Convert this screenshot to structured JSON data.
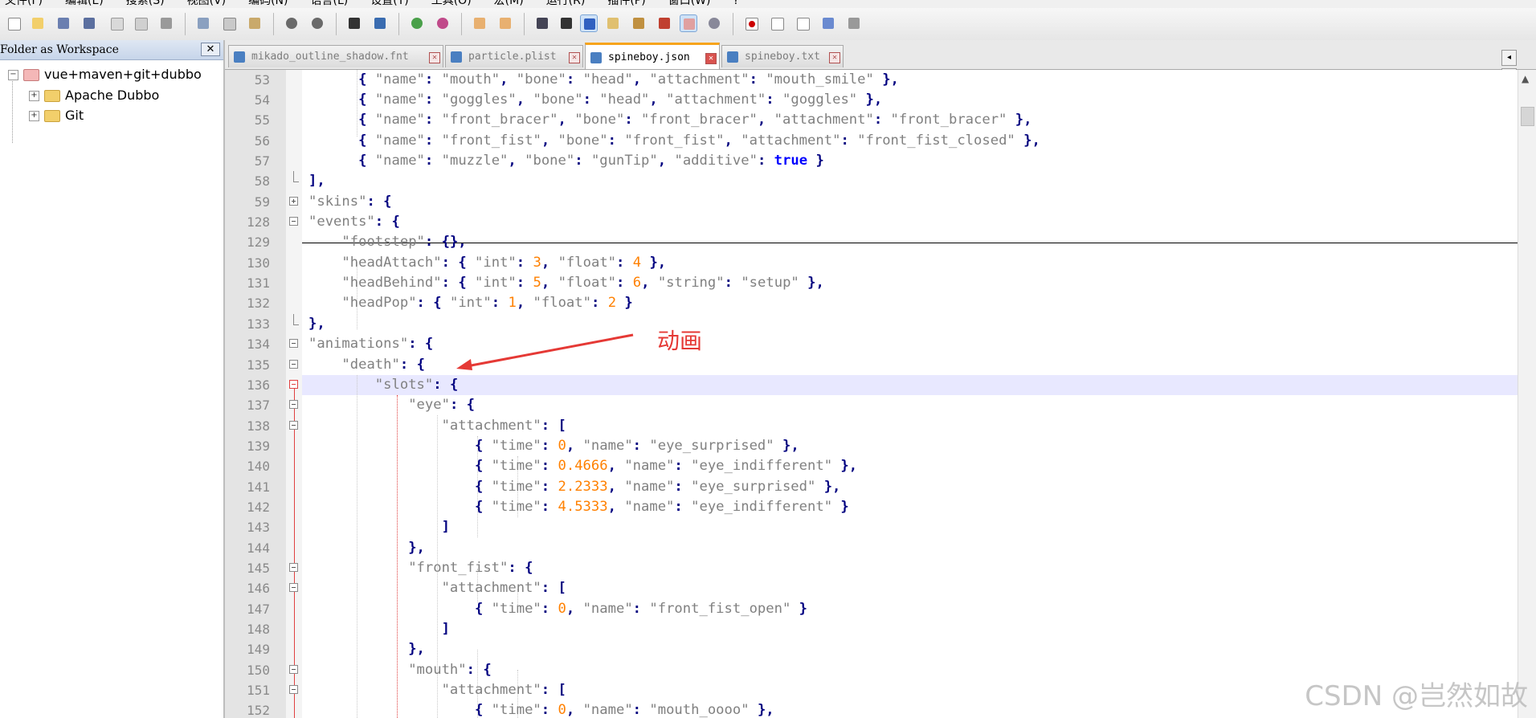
{
  "menu": [
    "文件(F)",
    "编辑(E)",
    "搜索(S)",
    "视图(V)",
    "编码(N)",
    "语言(L)",
    "设置(T)",
    "工具(O)",
    "宏(M)",
    "运行(R)",
    "插件(P)",
    "窗口(W)",
    "?"
  ],
  "panel": {
    "title": "Folder as Workspace",
    "close": "✕",
    "tree": [
      {
        "label": "vue+maven+git+dubbo",
        "expand": "−"
      },
      {
        "label": "Apache Dubbo",
        "expand": "+"
      },
      {
        "label": "Git",
        "expand": "+"
      }
    ]
  },
  "tabs": [
    {
      "label": "mikado_outline_shadow.fnt",
      "close": "✕"
    },
    {
      "label": "particle.plist",
      "close": "✕"
    },
    {
      "label": "spineboy.json",
      "close": "✕"
    },
    {
      "label": "spineboy.txt",
      "close": "✕"
    }
  ],
  "tabnav": [
    "◂",
    "▸"
  ],
  "editor": {
    "lines": [
      {
        "num": "53"
      },
      {
        "num": "54"
      },
      {
        "num": "55"
      },
      {
        "num": "56"
      },
      {
        "num": "57"
      },
      {
        "num": "58"
      },
      {
        "num": "59"
      },
      {
        "num": "128"
      },
      {
        "num": "129"
      },
      {
        "num": "130"
      },
      {
        "num": "131"
      },
      {
        "num": "132"
      },
      {
        "num": "133"
      },
      {
        "num": "134"
      },
      {
        "num": "135"
      },
      {
        "num": "136"
      },
      {
        "num": "137"
      },
      {
        "num": "138"
      },
      {
        "num": "139"
      },
      {
        "num": "140"
      },
      {
        "num": "141"
      },
      {
        "num": "142"
      },
      {
        "num": "143"
      },
      {
        "num": "144"
      },
      {
        "num": "145"
      },
      {
        "num": "146"
      },
      {
        "num": "147"
      },
      {
        "num": "148"
      },
      {
        "num": "149"
      },
      {
        "num": "150"
      },
      {
        "num": "151"
      },
      {
        "num": "152"
      }
    ]
  },
  "annotation": "动画",
  "watermark": "CSDN @岂然如故",
  "colors": {
    "annotation": "#e53935",
    "active_tab_accent": "#f7a41d",
    "current_line": "#e8e8ff"
  }
}
